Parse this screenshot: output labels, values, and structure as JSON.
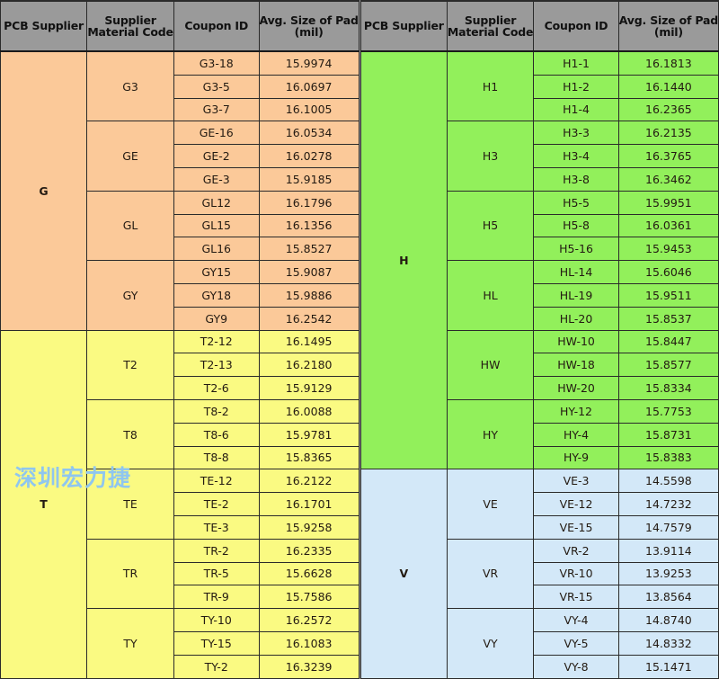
{
  "headers": {
    "pcb_supplier": "PCB Supplier",
    "supplier_material_code_l1": "Supplier",
    "supplier_material_code_l2": "Material Code",
    "coupon_id": "Coupon ID",
    "avg_size_l1": "Avg. Size of Pad",
    "avg_size_l2": "(mil)"
  },
  "watermark": "深圳宏力捷",
  "colors": {
    "header_gray": "#9a9a9a",
    "orange": "#fbc999",
    "yellow": "#fafa82",
    "green": "#92f05b",
    "blue": "#d3e8f8",
    "grid_line": "#2a2a2a",
    "watermark_blue": "#8fc6ef"
  },
  "chart_data": {
    "type": "table",
    "title": "Avg. Size of Pad (mil) by PCB Supplier, Supplier Material Code and Coupon ID",
    "columns": [
      "PCB Supplier",
      "Supplier Material Code",
      "Coupon ID",
      "Avg. Size of Pad (mil)"
    ],
    "rows": [
      [
        "G",
        "G3",
        "G3-18",
        "15.9974"
      ],
      [
        "G",
        "G3",
        "G3-5",
        "16.0697"
      ],
      [
        "G",
        "G3",
        "G3-7",
        "16.1005"
      ],
      [
        "G",
        "GE",
        "GE-16",
        "16.0534"
      ],
      [
        "G",
        "GE",
        "GE-2",
        "16.0278"
      ],
      [
        "G",
        "GE",
        "GE-3",
        "15.9185"
      ],
      [
        "G",
        "GL",
        "GL12",
        "16.1796"
      ],
      [
        "G",
        "GL",
        "GL15",
        "16.1356"
      ],
      [
        "G",
        "GL",
        "GL16",
        "15.8527"
      ],
      [
        "G",
        "GY",
        "GY15",
        "15.9087"
      ],
      [
        "G",
        "GY",
        "GY18",
        "15.9886"
      ],
      [
        "G",
        "GY",
        "GY9",
        "16.2542"
      ],
      [
        "T",
        "T2",
        "T2-12",
        "16.1495"
      ],
      [
        "T",
        "T2",
        "T2-13",
        "16.2180"
      ],
      [
        "T",
        "T2",
        "T2-6",
        "15.9129"
      ],
      [
        "T",
        "T8",
        "T8-2",
        "16.0088"
      ],
      [
        "T",
        "T8",
        "T8-6",
        "15.9781"
      ],
      [
        "T",
        "T8",
        "T8-8",
        "15.8365"
      ],
      [
        "T",
        "TE",
        "TE-12",
        "16.2122"
      ],
      [
        "T",
        "TE",
        "TE-2",
        "16.1701"
      ],
      [
        "T",
        "TE",
        "TE-3",
        "15.9258"
      ],
      [
        "T",
        "TR",
        "TR-2",
        "16.2335"
      ],
      [
        "T",
        "TR",
        "TR-5",
        "15.6628"
      ],
      [
        "T",
        "TR",
        "TR-9",
        "15.7586"
      ],
      [
        "T",
        "TY",
        "TY-10",
        "16.2572"
      ],
      [
        "T",
        "TY",
        "TY-15",
        "16.1083"
      ],
      [
        "T",
        "TY",
        "TY-2",
        "16.3239"
      ],
      [
        "H",
        "H1",
        "H1-1",
        "16.1813"
      ],
      [
        "H",
        "H1",
        "H1-2",
        "16.1440"
      ],
      [
        "H",
        "H1",
        "H1-4",
        "16.2365"
      ],
      [
        "H",
        "H3",
        "H3-3",
        "16.2135"
      ],
      [
        "H",
        "H3",
        "H3-4",
        "16.3765"
      ],
      [
        "H",
        "H3",
        "H3-8",
        "16.3462"
      ],
      [
        "H",
        "H5",
        "H5-5",
        "15.9951"
      ],
      [
        "H",
        "H5",
        "H5-8",
        "16.0361"
      ],
      [
        "H",
        "H5",
        "H5-16",
        "15.9453"
      ],
      [
        "H",
        "HL",
        "HL-14",
        "15.6046"
      ],
      [
        "H",
        "HL",
        "HL-19",
        "15.9511"
      ],
      [
        "H",
        "HL",
        "HL-20",
        "15.8537"
      ],
      [
        "H",
        "HW",
        "HW-10",
        "15.8447"
      ],
      [
        "H",
        "HW",
        "HW-18",
        "15.8577"
      ],
      [
        "H",
        "HW",
        "HW-20",
        "15.8334"
      ],
      [
        "H",
        "HY",
        "HY-12",
        "15.7753"
      ],
      [
        "H",
        "HY",
        "HY-4",
        "15.8731"
      ],
      [
        "H",
        "HY",
        "HY-9",
        "15.8383"
      ],
      [
        "V",
        "VE",
        "VE-3",
        "14.5598"
      ],
      [
        "V",
        "VE",
        "VE-12",
        "14.7232"
      ],
      [
        "V",
        "VE",
        "VE-15",
        "14.7579"
      ],
      [
        "V",
        "VR",
        "VR-2",
        "13.9114"
      ],
      [
        "V",
        "VR",
        "VR-10",
        "13.9253"
      ],
      [
        "V",
        "VR",
        "VR-15",
        "13.8564"
      ],
      [
        "V",
        "VY",
        "VY-4",
        "14.8740"
      ],
      [
        "V",
        "VY",
        "VY-5",
        "14.8332"
      ],
      [
        "V",
        "VY",
        "VY-8",
        "15.1471"
      ]
    ]
  },
  "left_table": {
    "suppliers": [
      {
        "name": "G",
        "fill": "orange",
        "materials": [
          {
            "code": "G3",
            "coupons": [
              {
                "id": "G3-18",
                "avg": "15.9974"
              },
              {
                "id": "G3-5",
                "avg": "16.0697"
              },
              {
                "id": "G3-7",
                "avg": "16.1005"
              }
            ]
          },
          {
            "code": "GE",
            "coupons": [
              {
                "id": "GE-16",
                "avg": "16.0534"
              },
              {
                "id": "GE-2",
                "avg": "16.0278"
              },
              {
                "id": "GE-3",
                "avg": "15.9185"
              }
            ]
          },
          {
            "code": "GL",
            "coupons": [
              {
                "id": "GL12",
                "avg": "16.1796"
              },
              {
                "id": "GL15",
                "avg": "16.1356"
              },
              {
                "id": "GL16",
                "avg": "15.8527"
              }
            ]
          },
          {
            "code": "GY",
            "coupons": [
              {
                "id": "GY15",
                "avg": "15.9087"
              },
              {
                "id": "GY18",
                "avg": "15.9886"
              },
              {
                "id": "GY9",
                "avg": "16.2542"
              }
            ]
          }
        ]
      },
      {
        "name": "T",
        "fill": "yellow",
        "materials": [
          {
            "code": "T2",
            "coupons": [
              {
                "id": "T2-12",
                "avg": "16.1495"
              },
              {
                "id": "T2-13",
                "avg": "16.2180"
              },
              {
                "id": "T2-6",
                "avg": "15.9129"
              }
            ]
          },
          {
            "code": "T8",
            "coupons": [
              {
                "id": "T8-2",
                "avg": "16.0088"
              },
              {
                "id": "T8-6",
                "avg": "15.9781"
              },
              {
                "id": "T8-8",
                "avg": "15.8365"
              }
            ]
          },
          {
            "code": "TE",
            "coupons": [
              {
                "id": "TE-12",
                "avg": "16.2122"
              },
              {
                "id": "TE-2",
                "avg": "16.1701"
              },
              {
                "id": "TE-3",
                "avg": "15.9258"
              }
            ]
          },
          {
            "code": "TR",
            "coupons": [
              {
                "id": "TR-2",
                "avg": "16.2335"
              },
              {
                "id": "TR-5",
                "avg": "15.6628"
              },
              {
                "id": "TR-9",
                "avg": "15.7586"
              }
            ]
          },
          {
            "code": "TY",
            "coupons": [
              {
                "id": "TY-10",
                "avg": "16.2572"
              },
              {
                "id": "TY-15",
                "avg": "16.1083"
              },
              {
                "id": "TY-2",
                "avg": "16.3239"
              }
            ]
          }
        ]
      }
    ]
  },
  "right_table": {
    "suppliers": [
      {
        "name": "H",
        "fill": "green",
        "materials": [
          {
            "code": "H1",
            "coupons": [
              {
                "id": "H1-1",
                "avg": "16.1813"
              },
              {
                "id": "H1-2",
                "avg": "16.1440"
              },
              {
                "id": "H1-4",
                "avg": "16.2365"
              }
            ]
          },
          {
            "code": "H3",
            "coupons": [
              {
                "id": "H3-3",
                "avg": "16.2135"
              },
              {
                "id": "H3-4",
                "avg": "16.3765"
              },
              {
                "id": "H3-8",
                "avg": "16.3462"
              }
            ]
          },
          {
            "code": "H5",
            "coupons": [
              {
                "id": "H5-5",
                "avg": "15.9951"
              },
              {
                "id": "H5-8",
                "avg": "16.0361"
              },
              {
                "id": "H5-16",
                "avg": "15.9453"
              }
            ]
          },
          {
            "code": "HL",
            "coupons": [
              {
                "id": "HL-14",
                "avg": "15.6046"
              },
              {
                "id": "HL-19",
                "avg": "15.9511"
              },
              {
                "id": "HL-20",
                "avg": "15.8537"
              }
            ]
          },
          {
            "code": "HW",
            "coupons": [
              {
                "id": "HW-10",
                "avg": "15.8447"
              },
              {
                "id": "HW-18",
                "avg": "15.8577"
              },
              {
                "id": "HW-20",
                "avg": "15.8334"
              }
            ]
          },
          {
            "code": "HY",
            "coupons": [
              {
                "id": "HY-12",
                "avg": "15.7753"
              },
              {
                "id": "HY-4",
                "avg": "15.8731"
              },
              {
                "id": "HY-9",
                "avg": "15.8383"
              }
            ]
          }
        ]
      },
      {
        "name": "V",
        "fill": "blue",
        "materials": [
          {
            "code": "VE",
            "coupons": [
              {
                "id": "VE-3",
                "avg": "14.5598"
              },
              {
                "id": "VE-12",
                "avg": "14.7232"
              },
              {
                "id": "VE-15",
                "avg": "14.7579"
              }
            ]
          },
          {
            "code": "VR",
            "coupons": [
              {
                "id": "VR-2",
                "avg": "13.9114"
              },
              {
                "id": "VR-10",
                "avg": "13.9253"
              },
              {
                "id": "VR-15",
                "avg": "13.8564"
              }
            ]
          },
          {
            "code": "VY",
            "coupons": [
              {
                "id": "VY-4",
                "avg": "14.8740"
              },
              {
                "id": "VY-5",
                "avg": "14.8332"
              },
              {
                "id": "VY-8",
                "avg": "15.1471"
              }
            ]
          }
        ]
      }
    ]
  }
}
